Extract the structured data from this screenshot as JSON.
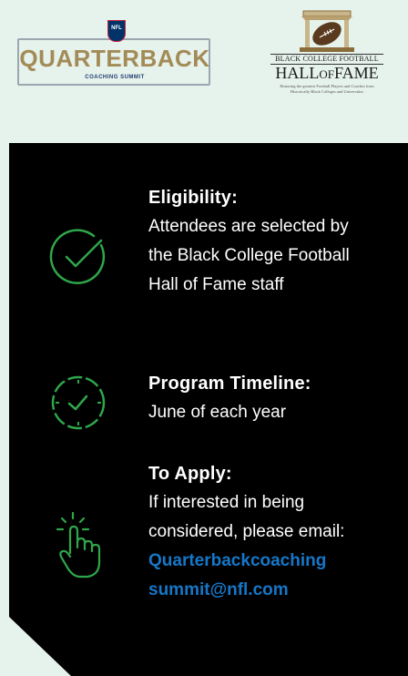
{
  "logos": {
    "qb": {
      "badge": "NFL",
      "word": "QUARTERBACK",
      "sub": "COACHING SUMMIT"
    },
    "hof": {
      "line1": "BLACK COLLEGE FOOTBALL",
      "line2_a": "HALL",
      "line2_b": "OF",
      "line2_c": "FAME",
      "tagline": "Honoring the greatest Football Players and Coaches from Historically Black Colleges and Universities"
    }
  },
  "info": {
    "eligibility": {
      "heading": "Eligibility:",
      "body": "Attendees are selected by the Black College Football Hall of Fame staff",
      "icon": "check-circle-icon"
    },
    "timeline": {
      "heading": "Program Timeline:",
      "body": "June of each year",
      "icon": "clock-icon"
    },
    "apply": {
      "heading": "To Apply:",
      "body": "If interested in being considered, please email:",
      "email_line1": "Quarterbackcoaching",
      "email_line2": "summit@nfl.com",
      "icon": "tap-hand-icon"
    }
  },
  "colors": {
    "page_background": "#e6f2ec",
    "panel": "#000000",
    "icon_green": "#2fa64a",
    "link_blue": "#1677c8",
    "qb_gold": "#a38b57"
  }
}
